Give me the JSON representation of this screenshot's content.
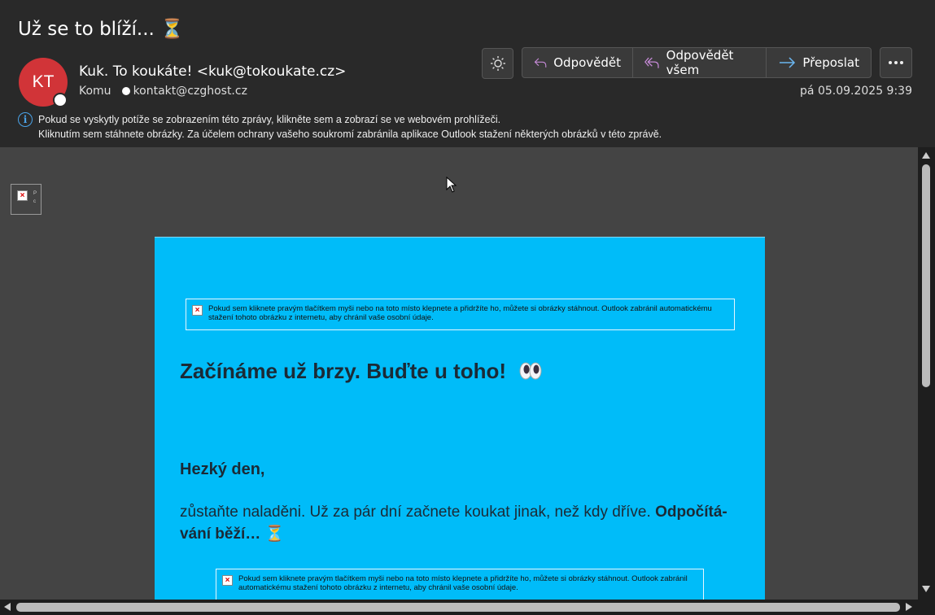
{
  "header": {
    "subject": "Už se to blíží... ⏳",
    "avatar_initials": "KT",
    "avatar_color": "#d13438",
    "sender": "Kuk. To koukáte! <kuk@tokoukate.cz>",
    "to_label": "Komu",
    "to_address": "kontakt@czghost.cz",
    "date": "pá 05.09.2025 9:39"
  },
  "actions": {
    "theme_icon": "sun-icon",
    "reply": "Odpovědět",
    "reply_all": "Odpovědět všem",
    "forward": "Přeposlat",
    "more_icon": "more-icon"
  },
  "infobar": {
    "line1": "Pokud se vyskytly potíže se zobrazením této zprávy, klikněte sem a zobrazí se ve webovém prohlížeči.",
    "line2": "Kliknutím sem stáhnete obrázky. Za účelem ochrany vašeho soukromí zabránila aplikace Outlook stažení některých obrázků v této zprávě."
  },
  "email": {
    "background_color": "#00bcf9",
    "blocked_image_text": "Pokud sem kliknete pravým tlačítkem myši nebo na toto místo klepnete a přidržíte ho, můžete si obrázky stáhnout. Outlook zabránil automatickému stažení tohoto obrázku z internetu, aby chránil vaše osobní údaje.",
    "heading": "Začínáme už brzy. Buďte u toho!",
    "heading_emoji": "eyes-icon",
    "greeting": "Hezký den,",
    "paragraph_start": "zůstaňte naladěni. Už za pár dní začnete koukat jinak, než kdy dříve. ",
    "paragraph_bold": "Odpočítá-vání běží… ⏳"
  }
}
